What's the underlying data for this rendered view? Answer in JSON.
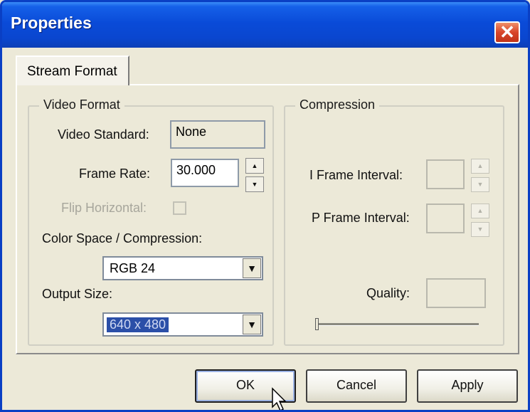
{
  "window": {
    "title": "Properties",
    "close_glyph": "✕"
  },
  "tabs": [
    {
      "label": "Stream Format",
      "active": true
    }
  ],
  "video_format": {
    "title": "Video Format",
    "video_standard_label": "Video Standard:",
    "video_standard_value": "None",
    "frame_rate_label": "Frame Rate:",
    "frame_rate_value": "30.000",
    "flip_horizontal_label": "Flip Horizontal:",
    "flip_horizontal_checked": false,
    "color_space_label": "Color Space / Compression:",
    "color_space_value": "RGB 24",
    "output_size_label": "Output Size:",
    "output_size_value": "640 x 480"
  },
  "compression": {
    "title": "Compression",
    "i_frame_label": "I Frame Interval:",
    "i_frame_value": "",
    "p_frame_label": "P Frame Interval:",
    "p_frame_value": "",
    "quality_label": "Quality:",
    "quality_value": "",
    "quality_slider_level": 0
  },
  "buttons": {
    "ok": "OK",
    "cancel": "Cancel",
    "apply": "Apply"
  },
  "glyphs": {
    "spin_up": "▲",
    "spin_down": "▼",
    "dropdown": "▼"
  },
  "colors": {
    "titlebar": "#0a4bd8",
    "dialog_bg": "#ece9d8",
    "selection": "#2b4fa8",
    "close_button": "#d8462a"
  },
  "icons": {
    "close": "close-icon",
    "cursor": "mouse-pointer-icon"
  }
}
